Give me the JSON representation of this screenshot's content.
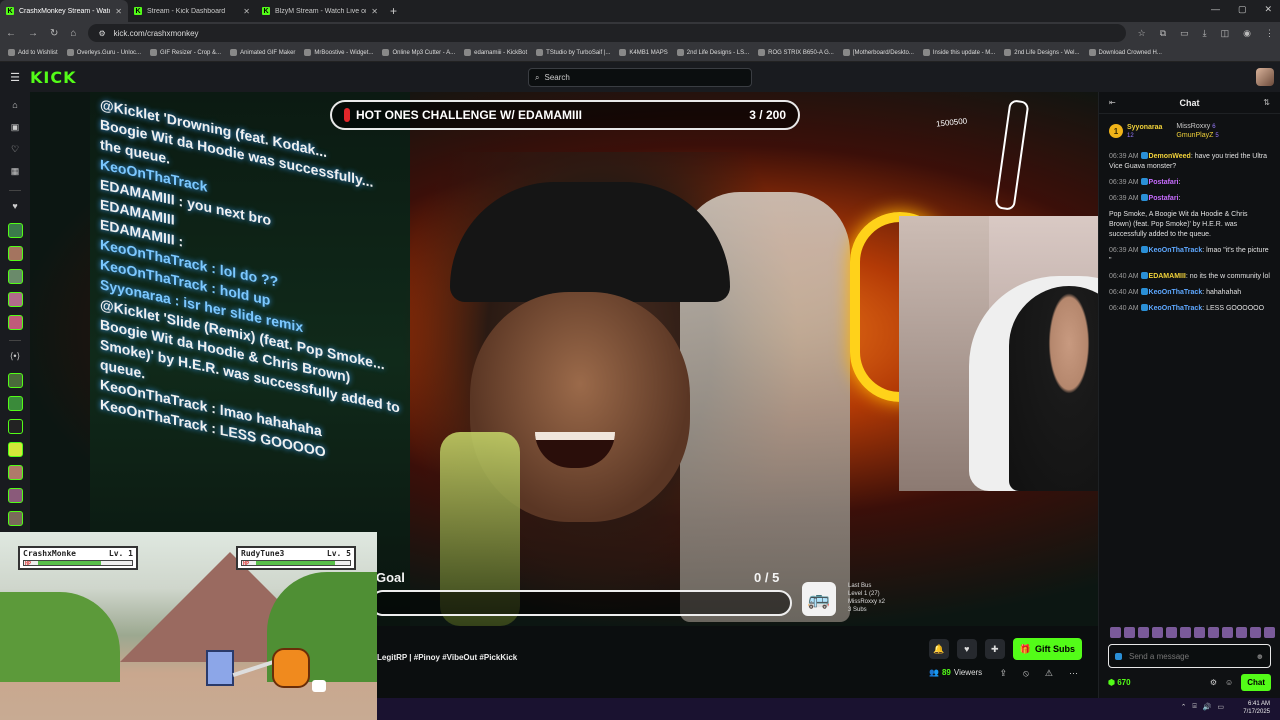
{
  "browser": {
    "tabs": [
      {
        "title": "CrashxMonkey Stream - Watc",
        "active": true
      },
      {
        "title": "Stream - Kick Dashboard",
        "active": false
      },
      {
        "title": "BlzyM Stream - Watch Live on Kic",
        "active": false
      }
    ],
    "url": "kick.com/crashxmonkey",
    "bookmarks": [
      "Add to Wishlist",
      "Overleys.Guru - Unloc...",
      "GIF Resizer - Crop &...",
      "Animated GIF Maker",
      "MrBoostive - Widget...",
      "Online Mp3 Cutter - A...",
      "edamamiii - KickBot",
      "TStudio by TurboSaif |...",
      "K4MB1 MAPS",
      "2nd Life Designs - LS...",
      "ROG STRIX B650-A G...",
      "[Motherboard/Deskto...",
      "Inside this update - M...",
      "2nd Life Designs - Wel...",
      "Download Crowned H..."
    ]
  },
  "kick": {
    "logo": "KICK",
    "search_placeholder": "Search"
  },
  "stream": {
    "banner_title": "HOT ONES CHALLENGE W/ EDAMAMIII",
    "banner_count": "3 / 200",
    "goal_label": "Goal",
    "goal_count": "0 / 5",
    "goal_progress": 0,
    "meter_value": "1500500",
    "bus": {
      "line1": "Last Bus",
      "line2": "Level 1  (27)",
      "line3": "MissRoxxy x2",
      "line4": "3 Subs"
    },
    "projected_chat": [
      "@Kicklet 'Drowning (feat. Kodak...",
      "Boogie Wit da Hoodie was successfully...",
      "the queue.",
      "KeoOnThaTrack",
      "EDAMAMIII : you next bro",
      "EDAMAMIII",
      "EDAMAMIII :",
      "KeoOnThaTrack : lol do ??",
      "KeoOnThaTrack : hold up",
      "Syyonaraa : isr her slide remix",
      "@Kicklet 'Slide (Remix) (feat. Pop Smoke...",
      "Boogie Wit da Hoodie & Chris Brown)",
      "Smoke)' by H.E.R. was successfully added to",
      "queue.",
      "KeoOnThaTrack : lmao hahahaha",
      "KeoOnThaTrack : LESS GOOOOO"
    ]
  },
  "game": {
    "player1": {
      "name": "CrashxMonke",
      "level": "Lv. 1",
      "hp_label": "HP",
      "hp": 0.7
    },
    "player2": {
      "name": "RudyTune3",
      "level": "Lv. 5",
      "hp_label": "HP",
      "hp": 0.85
    }
  },
  "below": {
    "tags": "LegitRP | #Pinoy #VibeOut #PickKick",
    "gift_label": "Gift Subs",
    "viewers_count": "89",
    "viewers_label": "Viewers"
  },
  "chat": {
    "title": "Chat",
    "leader_main": {
      "name": "Syyonaraa",
      "value": "12"
    },
    "leader_side": [
      {
        "name": "MissRoxxy",
        "value": "6"
      },
      {
        "name": "GmunPlayZ",
        "value": "5"
      }
    ],
    "messages": [
      {
        "ts": "06:39 AM",
        "user": "DemonWeed",
        "color": "#f1d23a",
        "text": "have you tried the Ultra Vice Guava monster?"
      },
      {
        "ts": "06:39 AM",
        "user": "Postafari",
        "color": "#c86cff",
        "text": ""
      },
      {
        "ts": "06:39 AM",
        "user": "Postafari",
        "color": "#c86cff",
        "text": ""
      },
      {
        "ts": "",
        "user": "",
        "color": "#e0e0e0",
        "text": "Pop Smoke, A Boogie Wit da Hoodie & Chris Brown) (feat. Pop Smoke)' by H.E.R. was successfully added to the queue."
      },
      {
        "ts": "06:39 AM",
        "user": "KeoOnThaTrack",
        "color": "#5ea8ff",
        "text": "lmao \"it's the picture \""
      },
      {
        "ts": "06:40 AM",
        "user": "EDAMAMIII",
        "color": "#f1d23a",
        "text": "no its the w community lol"
      },
      {
        "ts": "06:40 AM",
        "user": "KeoOnThaTrack",
        "color": "#5ea8ff",
        "text": "hahahahah"
      },
      {
        "ts": "06:40 AM",
        "user": "KeoOnThaTrack",
        "color": "#5ea8ff",
        "text": "LESS GOOOOOO"
      }
    ],
    "input_placeholder": "Send a message",
    "points": "670",
    "send_label": "Chat"
  },
  "system": {
    "time": "6:41 AM",
    "date": "7/17/2025"
  },
  "colors": {
    "kick_green": "#53fc18",
    "bg": "#0b0e0f",
    "panel": "#191b1f"
  }
}
